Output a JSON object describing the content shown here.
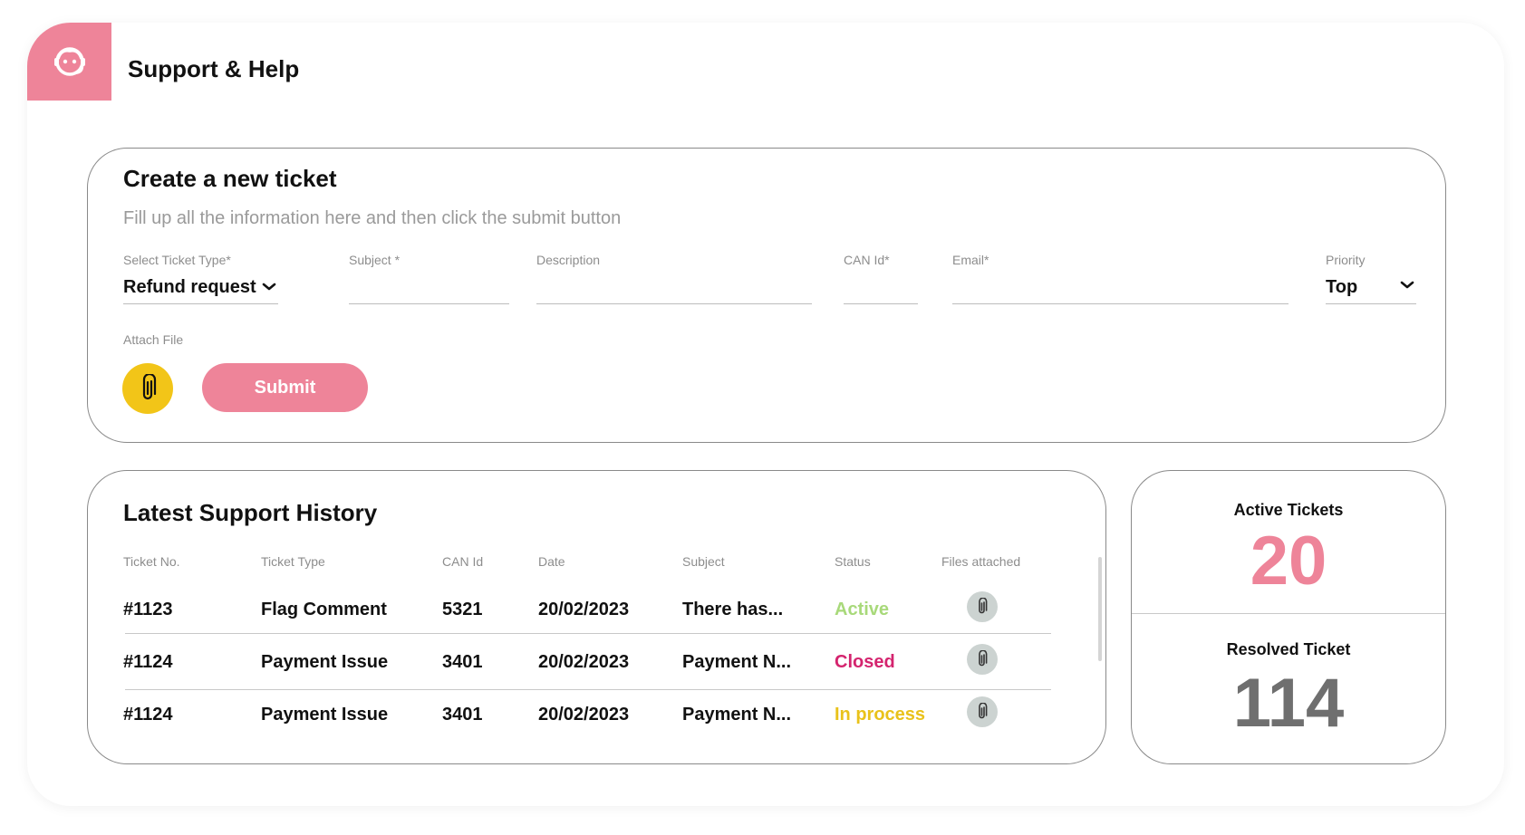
{
  "app": {
    "title": "Support & Help",
    "icon": "support-agent-icon"
  },
  "colors": {
    "accent_pink": "#EE8499",
    "attach_yellow": "#F2C518",
    "status_active": "#A8D97A",
    "status_closed": "#D4246E",
    "status_in_process": "#E9C21B",
    "resolved_gray": "#6f6f6f"
  },
  "create_ticket": {
    "title": "Create a new ticket",
    "subtitle": "Fill up all the information here and then click the submit button",
    "fields": {
      "ticket_type": {
        "label": "Select Ticket Type*",
        "value": "Refund request"
      },
      "subject": {
        "label": "Subject *",
        "value": ""
      },
      "description": {
        "label": "Description",
        "value": ""
      },
      "can_id": {
        "label": "CAN Id*",
        "value": ""
      },
      "email": {
        "label": "Email*",
        "value": ""
      },
      "priority": {
        "label": "Priority",
        "value": "Top"
      }
    },
    "attach_label": "Attach File",
    "submit_label": "Submit"
  },
  "history": {
    "title": "Latest Support History",
    "columns": [
      "Ticket No.",
      "Ticket Type",
      "CAN Id",
      "Date",
      "Subject",
      "Status",
      "Files attached"
    ],
    "rows": [
      {
        "ticket_no": "#1123",
        "type": "Flag Comment",
        "can_id": "5321",
        "date": "20/02/2023",
        "subject": "There has...",
        "status": "Active",
        "status_key": "active"
      },
      {
        "ticket_no": "#1124",
        "type": "Payment Issue",
        "can_id": "3401",
        "date": "20/02/2023",
        "subject": "Payment N...",
        "status": "Closed",
        "status_key": "closed"
      },
      {
        "ticket_no": "#1124",
        "type": "Payment Issue",
        "can_id": "3401",
        "date": "20/02/2023",
        "subject": "Payment N...",
        "status": "In process",
        "status_key": "in_process"
      }
    ]
  },
  "stats": {
    "active": {
      "label": "Active Tickets",
      "value": "20"
    },
    "resolved": {
      "label": "Resolved Ticket",
      "value": "114"
    }
  }
}
